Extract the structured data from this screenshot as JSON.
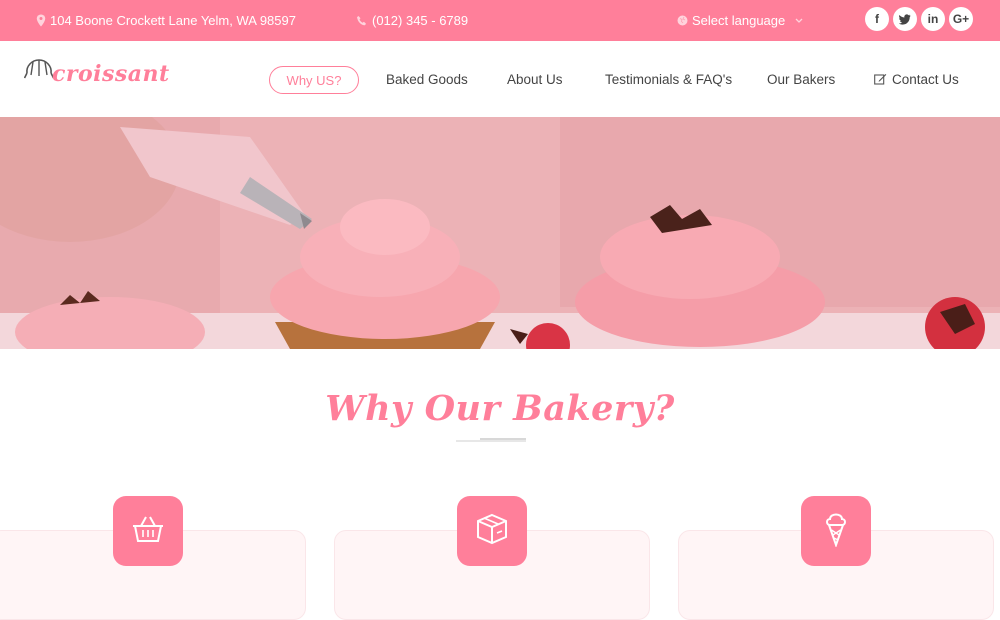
{
  "topbar": {
    "address": "104 Boone Crockett Lane Yelm, WA 98597",
    "phone": "(012) 345 - 6789",
    "language": "Select language",
    "social": [
      {
        "name": "facebook",
        "glyph": "f"
      },
      {
        "name": "twitter",
        "glyph": "t"
      },
      {
        "name": "linkedin",
        "glyph": "in"
      },
      {
        "name": "google-plus",
        "glyph": "G+"
      }
    ]
  },
  "brand": {
    "name": "croissant"
  },
  "nav": {
    "items": [
      "Why US?",
      "Baked Goods",
      "About Us",
      "Testimonials & FAQ's",
      "Our Bakers",
      "Contact Us"
    ],
    "active_index": 0
  },
  "section": {
    "title": "Why Our Bakery?"
  },
  "features": [
    {
      "icon": "basket-icon"
    },
    {
      "icon": "box-icon"
    },
    {
      "icon": "ice-cream-icon"
    }
  ],
  "colors": {
    "accent": "#ff7f9a",
    "text": "#444444",
    "card_bg": "#fff5f6"
  }
}
